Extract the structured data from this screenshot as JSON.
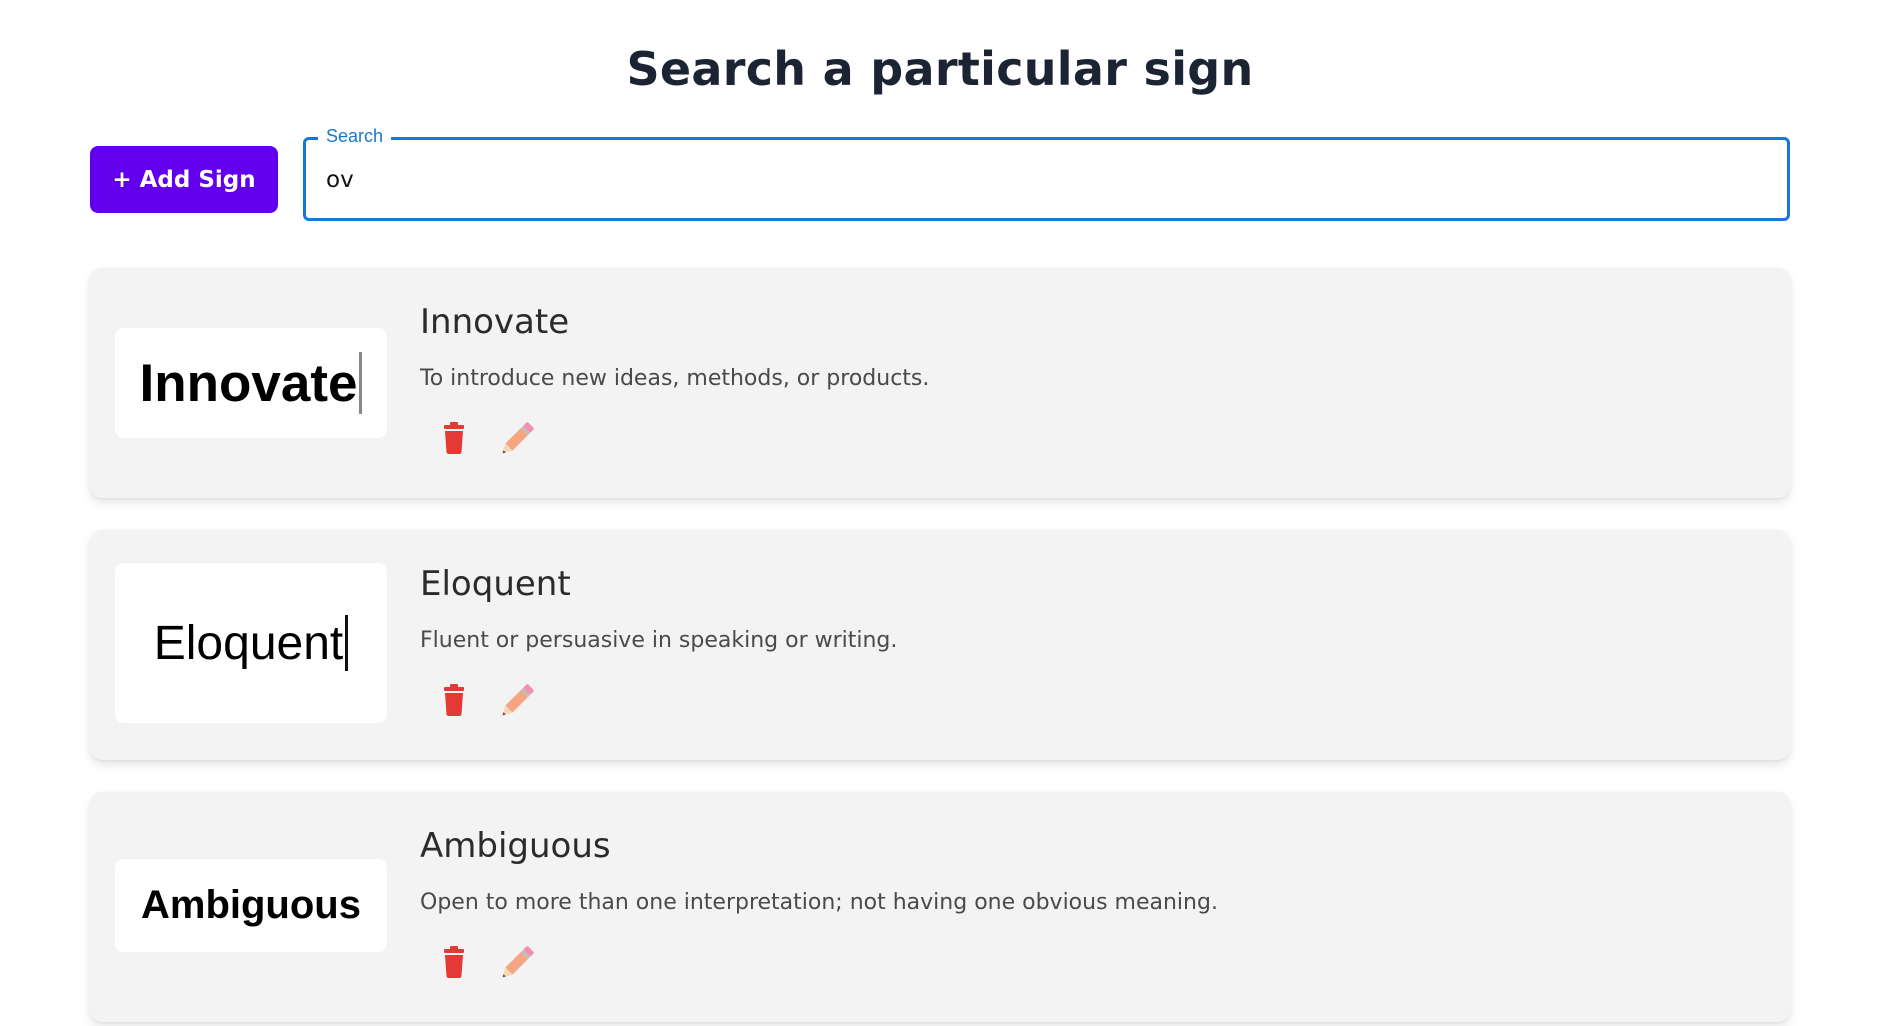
{
  "page": {
    "title": "Search a particular sign"
  },
  "toolbar": {
    "add_label": "+ Add Sign",
    "search_label": "Search",
    "search_value": "ov"
  },
  "colors": {
    "primary": "#6200ee",
    "search_border": "#1976d2",
    "delete": "#e53935",
    "edit": "#f4a582",
    "card_bg": "#f3f3f3"
  },
  "icons": {
    "delete": "trash-icon",
    "edit": "pencil-icon"
  },
  "signs": [
    {
      "image_text": "Innovate",
      "name": "Innovate",
      "description": "To introduce new ideas, methods, or products."
    },
    {
      "image_text": "Eloquent",
      "name": "Eloquent",
      "description": "Fluent or persuasive in speaking or writing."
    },
    {
      "image_text": "Ambiguous",
      "name": "Ambiguous",
      "description": "Open to more than one interpretation; not having one obvious meaning."
    }
  ]
}
